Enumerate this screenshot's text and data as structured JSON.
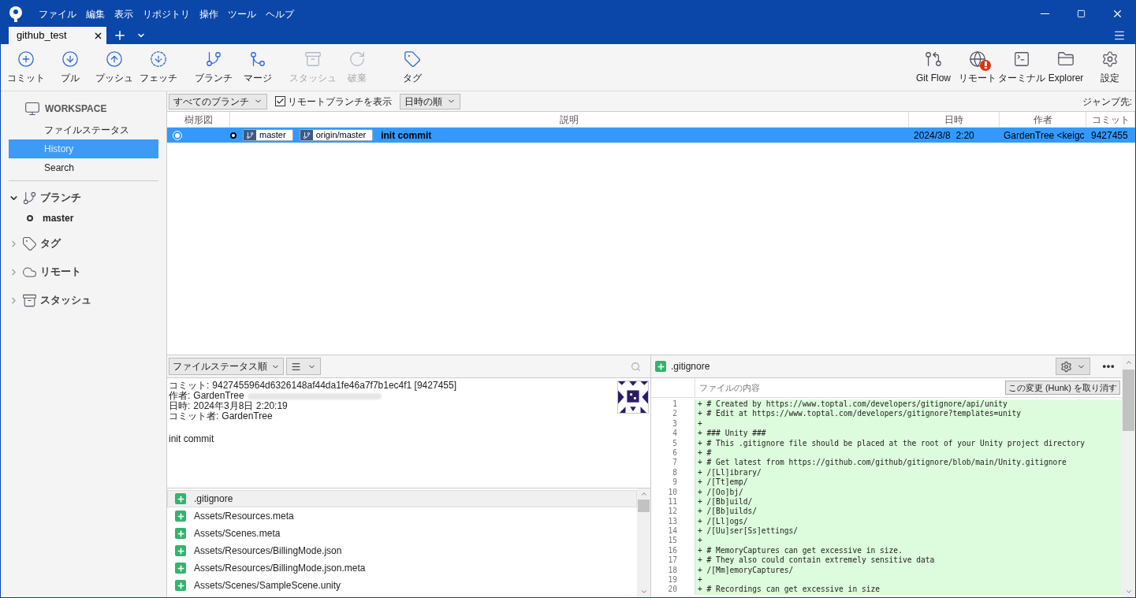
{
  "menu": [
    "ファイル",
    "編集",
    "表示",
    "リポジトリ",
    "操作",
    "ツール",
    "ヘルプ"
  ],
  "tabs": [
    {
      "label": "github_test",
      "selected": true
    }
  ],
  "toolbar_left": [
    {
      "kind": "commit",
      "label": "コミット",
      "disabled": false
    },
    {
      "kind": "pull",
      "label": "プル",
      "disabled": false
    },
    {
      "kind": "push",
      "label": "プッシュ",
      "disabled": false
    },
    {
      "kind": "fetch",
      "label": "フェッチ",
      "disabled": false
    },
    {
      "kind": "branch",
      "label": "ブランチ",
      "disabled": false
    },
    {
      "kind": "merge",
      "label": "マージ",
      "disabled": false
    },
    {
      "kind": "stash",
      "label": "スタッシュ",
      "disabled": true
    },
    {
      "kind": "discard",
      "label": "破棄",
      "disabled": true
    },
    {
      "kind": "tag",
      "label": "タグ",
      "disabled": false
    }
  ],
  "toolbar_right": [
    {
      "kind": "gitflow",
      "label": "Git Flow",
      "alert": false
    },
    {
      "kind": "remote",
      "label": "リモート",
      "alert": true
    },
    {
      "kind": "terminal",
      "label": "ターミナル",
      "alert": false
    },
    {
      "kind": "explorer",
      "label": "Explorer",
      "alert": false
    },
    {
      "kind": "settings",
      "label": "設定",
      "alert": false
    }
  ],
  "sidebar": {
    "workspace": {
      "title": "WORKSPACE",
      "items": [
        {
          "label": "ファイルステータス",
          "selected": false
        },
        {
          "label": "History",
          "selected": true
        },
        {
          "label": "Search",
          "selected": false
        }
      ]
    },
    "sections": [
      {
        "kind": "branch",
        "label": "ブランチ",
        "expanded": true,
        "children": [
          {
            "label": "master",
            "current": true
          }
        ]
      },
      {
        "kind": "tag",
        "label": "タグ",
        "expanded": false
      },
      {
        "kind": "remote",
        "label": "リモート",
        "expanded": false
      },
      {
        "kind": "stash",
        "label": "スタッシュ",
        "expanded": false
      }
    ]
  },
  "history_toolbar": {
    "branch_filter": "すべてのブランチ",
    "show_remote": {
      "label": "リモートブランチを表示",
      "checked": true
    },
    "sort": "日時の順",
    "jump_label": "ジャンプ先:"
  },
  "table": {
    "columns": [
      "樹形図",
      "説明",
      "日時",
      "作者",
      "コミット"
    ],
    "rows": [
      {
        "selected": true,
        "refs": [
          "master",
          "origin/master"
        ],
        "message": "init commit",
        "date": "2024/3/8  2:20",
        "author": "GardenTree <keigc",
        "commit": "9427455"
      }
    ]
  },
  "details_toolbar": {
    "sort": "ファイルステータス順"
  },
  "commit_details": {
    "lines": [
      {
        "label": "コミット:",
        "value": "9427455964d6326148af44da1fe46a7f7b1ec4f1 [9427455]"
      },
      {
        "label": "作者:",
        "value": "GardenTree",
        "redacted": true
      },
      {
        "label": "日時:",
        "value": "2024年3月8日 2:20:19"
      },
      {
        "label": "コミット者:",
        "value": "GardenTree"
      }
    ],
    "message": "init commit"
  },
  "files": [
    {
      "name": ".gitignore",
      "selected": true
    },
    {
      "name": "Assets/Resources.meta",
      "selected": false
    },
    {
      "name": "Assets/Scenes.meta",
      "selected": false
    },
    {
      "name": "Assets/Resources/BillingMode.json",
      "selected": false
    },
    {
      "name": "Assets/Resources/BillingMode.json.meta",
      "selected": false
    },
    {
      "name": "Assets/Scenes/SampleScene.unity",
      "selected": false
    }
  ],
  "diff": {
    "file": ".gitignore",
    "header": "ファイルの内容",
    "discard_button": "この変更 (Hunk) を取り消す",
    "lines": [
      {
        "num": "1",
        "text": "+ # Created by https://www.toptal.com/developers/gitignore/api/unity"
      },
      {
        "num": "2",
        "text": "+ # Edit at https://www.toptal.com/developers/gitignore?templates=unity"
      },
      {
        "num": "3",
        "text": "+"
      },
      {
        "num": "4",
        "text": "+ ### Unity ###"
      },
      {
        "num": "5",
        "text": "+ # This .gitignore file should be placed at the root of your Unity project directory"
      },
      {
        "num": "6",
        "text": "+ #"
      },
      {
        "num": "7",
        "text": "+ # Get latest from https://github.com/github/gitignore/blob/main/Unity.gitignore"
      },
      {
        "num": "8",
        "text": "+ /[Ll]ibrary/"
      },
      {
        "num": "9",
        "text": "+ /[Tt]emp/"
      },
      {
        "num": "10",
        "text": "+ /[Oo]bj/"
      },
      {
        "num": "11",
        "text": "+ /[Bb]uild/"
      },
      {
        "num": "12",
        "text": "+ /[Bb]uilds/"
      },
      {
        "num": "13",
        "text": "+ /[Ll]ogs/"
      },
      {
        "num": "14",
        "text": "+ /[Uu]ser[Ss]ettings/"
      },
      {
        "num": "15",
        "text": "+"
      },
      {
        "num": "16",
        "text": "+ # MemoryCaptures can get excessive in size."
      },
      {
        "num": "17",
        "text": "+ # They also could contain extremely sensitive data"
      },
      {
        "num": "18",
        "text": "+ /[Mm]emoryCaptures/"
      },
      {
        "num": "19",
        "text": "+"
      },
      {
        "num": "20",
        "text": "+ # Recordings can get excessive in size"
      }
    ]
  }
}
